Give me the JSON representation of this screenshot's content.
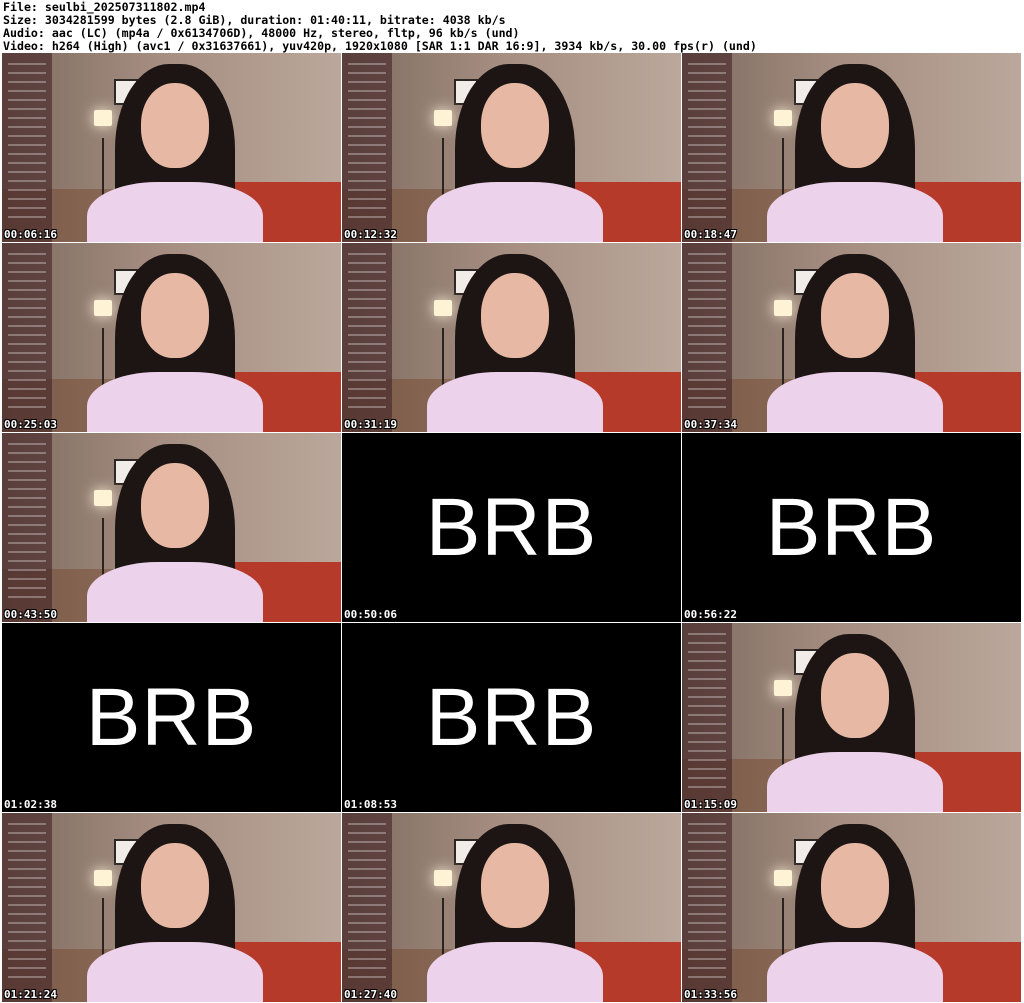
{
  "header": {
    "file": "File: seulbi_202507311802.mp4",
    "size": "Size: 3034281599 bytes (2.8 GiB), duration: 01:40:11, bitrate: 4038 kb/s",
    "audio": "Audio: aac (LC) (mp4a / 0x6134706D), 48000 Hz, stereo, fltp, 96 kb/s (und)",
    "video": "Video: h264 (High) (avc1 / 0x31637661), yuv420p, 1920x1080 [SAR 1:1 DAR 16:9], 3934 kb/s, 30.00 fps(r) (und)"
  },
  "thumbnails": [
    {
      "time": "00:06:16",
      "kind": "frame"
    },
    {
      "time": "00:12:32",
      "kind": "frame"
    },
    {
      "time": "00:18:47",
      "kind": "frame"
    },
    {
      "time": "00:25:03",
      "kind": "frame"
    },
    {
      "time": "00:31:19",
      "kind": "frame"
    },
    {
      "time": "00:37:34",
      "kind": "frame"
    },
    {
      "time": "00:43:50",
      "kind": "frame"
    },
    {
      "time": "00:50:06",
      "kind": "brb",
      "text": "BRB"
    },
    {
      "time": "00:56:22",
      "kind": "brb",
      "text": "BRB"
    },
    {
      "time": "01:02:38",
      "kind": "brb",
      "text": "BRB"
    },
    {
      "time": "01:08:53",
      "kind": "brb",
      "text": "BRB"
    },
    {
      "time": "01:15:09",
      "kind": "frame"
    },
    {
      "time": "01:21:24",
      "kind": "frame"
    },
    {
      "time": "01:27:40",
      "kind": "frame"
    },
    {
      "time": "01:33:56",
      "kind": "frame"
    }
  ]
}
